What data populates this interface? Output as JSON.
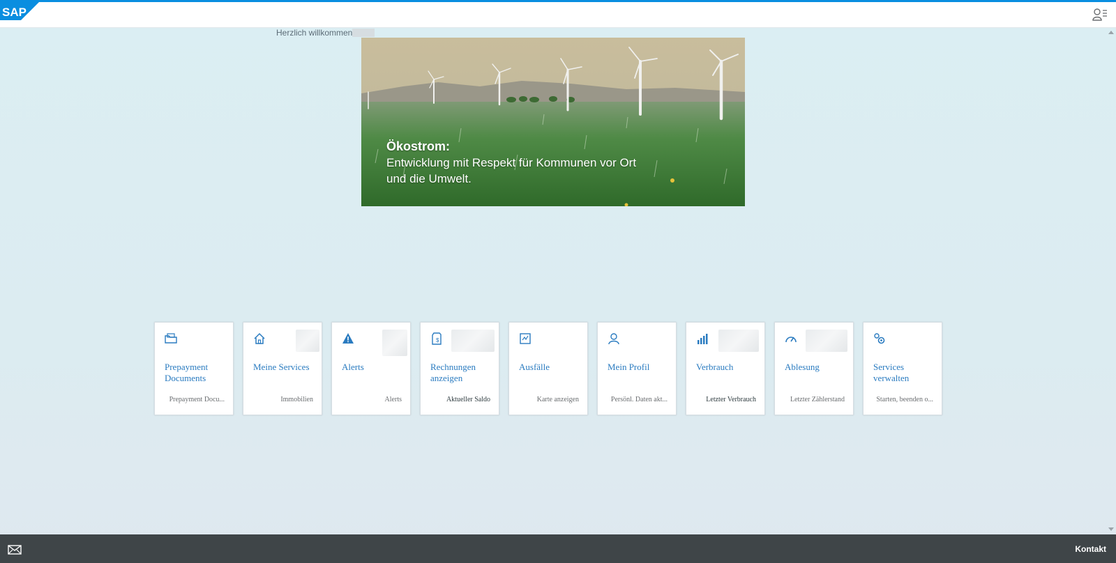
{
  "header": {
    "logo_text": "SAP",
    "user_icon": "user-menu-icon"
  },
  "welcome": {
    "text": "Herzlich willkommen"
  },
  "hero": {
    "title": "Ökostrom:",
    "line1": "Entwicklung mit Respekt für Kommunen vor Ort",
    "line2": "und die Umwelt."
  },
  "tiles": [
    {
      "title": "Prepayment Documents",
      "footer": "Prepayment Docu...",
      "icon": "folder-icon"
    },
    {
      "title": "Meine Services",
      "footer": "Immobilien",
      "icon": "home-icon"
    },
    {
      "title": "Alerts",
      "footer": "Alerts",
      "icon": "alert-icon"
    },
    {
      "title": "Rechnungen anzeigen",
      "footer": "Aktueller Saldo",
      "icon": "invoice-icon"
    },
    {
      "title": "Ausfälle",
      "footer": "Karte anzeigen",
      "icon": "outage-map-icon"
    },
    {
      "title": "Mein Profil",
      "footer": "Persönl. Daten akt...",
      "icon": "person-icon"
    },
    {
      "title": "Verbrauch",
      "footer": "Letzter Verbrauch",
      "icon": "bar-chart-icon"
    },
    {
      "title": "Ablesung",
      "footer": "Letzter Zählerstand",
      "icon": "gauge-icon"
    },
    {
      "title": "Services verwalten",
      "footer": "Starten, beenden o...",
      "icon": "settings-gears-icon"
    }
  ],
  "footer": {
    "contact_label": "Kontakt",
    "mail_icon": "mail-icon"
  },
  "colors": {
    "accent": "#0a8ee0",
    "tile_title": "#2a7bc0",
    "footer_bg": "#3f4548"
  }
}
